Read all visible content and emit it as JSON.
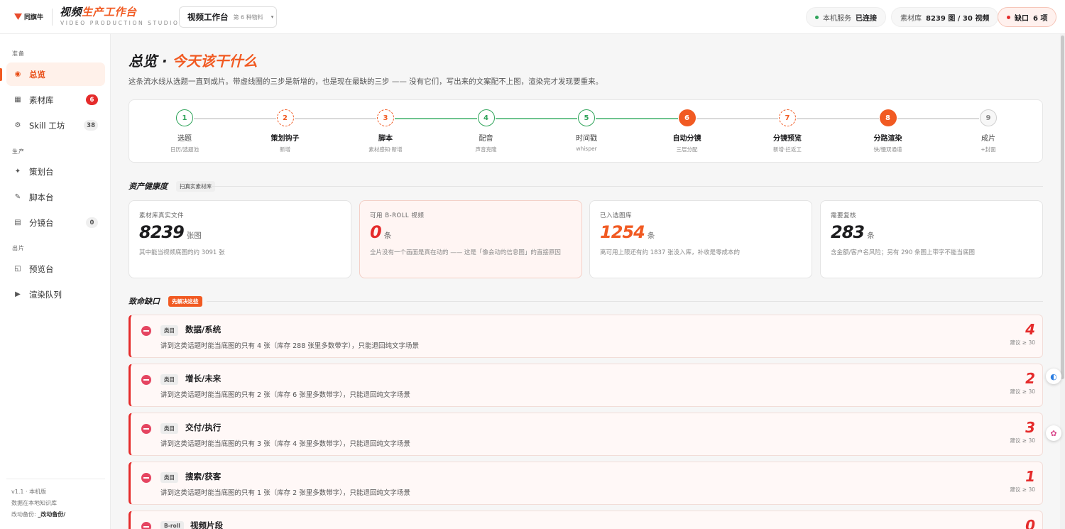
{
  "topbar": {
    "logo_text": "同旗牛",
    "title_part1": "视频",
    "title_part2": "生产工作台",
    "subtitle": "VIDEO PRODUCTION STUDIO",
    "workspace": {
      "label": "视频工作台",
      "sub": "第 6 种物料",
      "chevron": "▾"
    },
    "service_label": "本机服务",
    "service_value": "已连接",
    "library_label": "素材库",
    "library_value": "8239 图 / 30 视频",
    "gap_label": "缺口",
    "gap_value": "6 项",
    "colors": {
      "accent": "#f15a22",
      "ok": "#2fa45a",
      "danger": "#e52b2b"
    }
  },
  "sidebar": {
    "sections": [
      {
        "label": "准备",
        "items": [
          {
            "label": "总览",
            "icon": "target-icon",
            "active": true
          },
          {
            "label": "素材库",
            "icon": "grid-icon",
            "badge": "6",
            "badge_style": "red"
          },
          {
            "label": "Skill 工坊",
            "icon": "gear-icon",
            "badge": "38",
            "badge_style": "grey"
          }
        ]
      },
      {
        "label": "生产",
        "items": [
          {
            "label": "策划台",
            "icon": "sparkle-icon"
          },
          {
            "label": "脚本台",
            "icon": "pen-icon"
          },
          {
            "label": "分镜台",
            "icon": "storyboard-icon",
            "badge": "0",
            "badge_style": "grey"
          }
        ]
      },
      {
        "label": "出片",
        "items": [
          {
            "label": "预览台",
            "icon": "preview-icon"
          },
          {
            "label": "渲染队列",
            "icon": "play-icon"
          }
        ]
      }
    ],
    "footer": {
      "version": "v1.1 · 本机版",
      "storage": "数据在本地知识库",
      "backup_label": "改动备份:",
      "backup_value": "_改动备份/"
    }
  },
  "main": {
    "title_part1": "总览 · ",
    "title_part2": "今天该干什么",
    "description": "这条流水线从选题一直到成片。带虚线圈的三步是新增的，也是现在最缺的三步 —— 没有它们，写出来的文案配不上图，渲染完才发现要重来。",
    "pipeline": [
      {
        "num": "1",
        "name": "选题",
        "sub": "日历/选题池",
        "state": "done"
      },
      {
        "num": "2",
        "name": "策划钩子",
        "sub": "新增",
        "state": "dash"
      },
      {
        "num": "3",
        "name": "脚本",
        "sub": "素材感知·新增",
        "state": "dash"
      },
      {
        "num": "4",
        "name": "配音",
        "sub": "声音克隆",
        "state": "done"
      },
      {
        "num": "5",
        "name": "时间戳",
        "sub": "whisper",
        "state": "done"
      },
      {
        "num": "6",
        "name": "自动分镜",
        "sub": "三层分配",
        "state": "fill"
      },
      {
        "num": "7",
        "name": "分镜预览",
        "sub": "新增·拦返工",
        "state": "dash"
      },
      {
        "num": "8",
        "name": "分路渲染",
        "sub": "快/慢双通道",
        "state": "fill"
      },
      {
        "num": "9",
        "name": "成片",
        "sub": "+封面",
        "state": "todo"
      }
    ],
    "health": {
      "title": "资产健康度",
      "tag": "扫真实素材库",
      "cards": [
        {
          "label": "素材库真实文件",
          "value": "8239",
          "unit": "张图",
          "note": "其中能当视频底图的约 3091 张",
          "style": "normal"
        },
        {
          "label": "可用 B-ROLL 视频",
          "value": "0",
          "unit": "条",
          "note": "全片没有一个画面是真在动的 —— 这是「像会动的信息图」的直接原因",
          "style": "alert"
        },
        {
          "label": "已入选图库",
          "value": "1254",
          "unit": "条",
          "note": "离可用上限还有约 1837 张没入库，补收是零成本的",
          "style": "orange"
        },
        {
          "label": "需要复核",
          "value": "283",
          "unit": "条",
          "note": "含金额/客户名风险；另有 290 条图上带字不能当底图",
          "style": "normal"
        }
      ]
    },
    "gaps": {
      "title": "致命缺口",
      "tag": "先解决这些",
      "items": [
        {
          "cat": "类目",
          "name": "数据/系统",
          "desc": "讲到这类话题时能当底图的只有 4 张（库存 288 张里多数带字），只能退回纯文字场景",
          "count": "4",
          "suggest": "建议 ≥ 30"
        },
        {
          "cat": "类目",
          "name": "增长/未来",
          "desc": "讲到这类话题时能当底图的只有 2 张（库存 6 张里多数带字），只能退回纯文字场景",
          "count": "2",
          "suggest": "建议 ≥ 30"
        },
        {
          "cat": "类目",
          "name": "交付/执行",
          "desc": "讲到这类话题时能当底图的只有 3 张（库存 4 张里多数带字），只能退回纯文字场景",
          "count": "3",
          "suggest": "建议 ≥ 30"
        },
        {
          "cat": "类目",
          "name": "搜索/获客",
          "desc": "讲到这类话题时能当底图的只有 1 张（库存 2 张里多数带字），只能退回纯文字场景",
          "count": "1",
          "suggest": "建议 ≥ 30"
        },
        {
          "cat": "B-roll",
          "name": "视频片段",
          "desc": "",
          "count": "0",
          "suggest": ""
        }
      ]
    }
  }
}
